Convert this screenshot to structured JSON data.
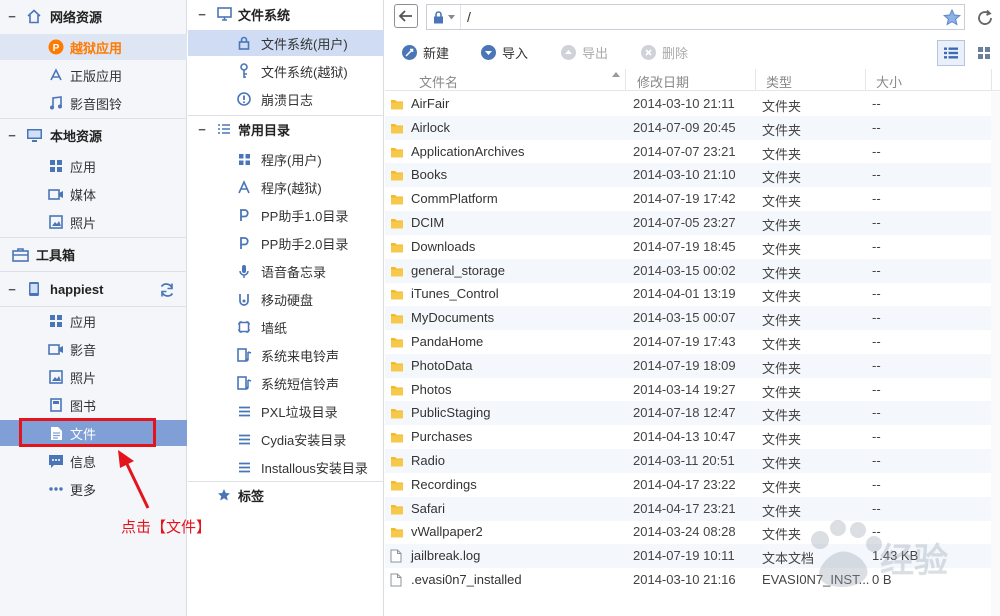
{
  "sidebar": {
    "groups": [
      {
        "title": "网络资源",
        "icon": "home-icon",
        "items": [
          {
            "label": "越狱应用",
            "icon": "pp-icon",
            "state": "active"
          },
          {
            "label": "正版应用",
            "icon": "appstore-icon"
          },
          {
            "label": "影音图铃",
            "icon": "music-icon"
          }
        ]
      },
      {
        "title": "本地资源",
        "icon": "monitor-icon",
        "items": [
          {
            "label": "应用",
            "icon": "grid-icon"
          },
          {
            "label": "媒体",
            "icon": "video-icon"
          },
          {
            "label": "照片",
            "icon": "photo-icon"
          }
        ]
      },
      {
        "title": "工具箱",
        "icon": "toolbox-icon",
        "items": []
      },
      {
        "title": "happiest",
        "icon": "phone-icon",
        "items": [
          {
            "label": "应用",
            "icon": "grid-icon"
          },
          {
            "label": "影音",
            "icon": "video-icon"
          },
          {
            "label": "照片",
            "icon": "photo-icon"
          },
          {
            "label": "图书",
            "icon": "book-icon"
          },
          {
            "label": "文件",
            "icon": "file-icon",
            "state": "selected"
          },
          {
            "label": "信息",
            "icon": "message-icon"
          },
          {
            "label": "更多",
            "icon": "more-icon"
          }
        ]
      }
    ]
  },
  "tree": {
    "filesystem_title": "文件系统",
    "filesystem_items": [
      {
        "label": "文件系统(用户)",
        "icon": "lock-icon",
        "selected": true
      },
      {
        "label": "文件系统(越狱)",
        "icon": "key-icon"
      },
      {
        "label": "崩溃日志",
        "icon": "alert-icon"
      }
    ],
    "common_title": "常用目录",
    "common_items": [
      {
        "label": "程序(用户)",
        "icon": "grid-icon"
      },
      {
        "label": "程序(越狱)",
        "icon": "app-a-icon"
      },
      {
        "label": "PP助手1.0目录",
        "icon": "pp-small-icon"
      },
      {
        "label": "PP助手2.0目录",
        "icon": "pp-small-icon"
      },
      {
        "label": "语音备忘录",
        "icon": "mic-icon"
      },
      {
        "label": "移动硬盘",
        "icon": "drive-icon"
      },
      {
        "label": "墙纸",
        "icon": "wallpaper-icon"
      },
      {
        "label": "系统来电铃声",
        "icon": "ringtone-icon"
      },
      {
        "label": "系统短信铃声",
        "icon": "ringtone-icon"
      },
      {
        "label": "PXL垃圾目录",
        "icon": "list-icon"
      },
      {
        "label": "Cydia安装目录",
        "icon": "list-icon"
      },
      {
        "label": "Installous安装目录",
        "icon": "list-icon"
      }
    ],
    "tags_title": "标签"
  },
  "address_bar": {
    "path": "/"
  },
  "toolbar": {
    "new_label": "新建",
    "import_label": "导入",
    "export_label": "导出",
    "delete_label": "删除"
  },
  "columns": {
    "name": "文件名",
    "date": "修改日期",
    "type": "类型",
    "size": "大小"
  },
  "files": [
    {
      "name": "AirFair",
      "date": "2014-03-10 21:11",
      "type": "文件夹",
      "size": "--",
      "kind": "folder"
    },
    {
      "name": "Airlock",
      "date": "2014-07-09 20:45",
      "type": "文件夹",
      "size": "--",
      "kind": "folder"
    },
    {
      "name": "ApplicationArchives",
      "date": "2014-07-07 23:21",
      "type": "文件夹",
      "size": "--",
      "kind": "folder"
    },
    {
      "name": "Books",
      "date": "2014-03-10 21:10",
      "type": "文件夹",
      "size": "--",
      "kind": "folder"
    },
    {
      "name": "CommPlatform",
      "date": "2014-07-19 17:42",
      "type": "文件夹",
      "size": "--",
      "kind": "folder"
    },
    {
      "name": "DCIM",
      "date": "2014-07-05 23:27",
      "type": "文件夹",
      "size": "--",
      "kind": "folder"
    },
    {
      "name": "Downloads",
      "date": "2014-07-19 18:45",
      "type": "文件夹",
      "size": "--",
      "kind": "folder"
    },
    {
      "name": "general_storage",
      "date": "2014-03-15 00:02",
      "type": "文件夹",
      "size": "--",
      "kind": "folder"
    },
    {
      "name": "iTunes_Control",
      "date": "2014-04-01 13:19",
      "type": "文件夹",
      "size": "--",
      "kind": "folder"
    },
    {
      "name": "MyDocuments",
      "date": "2014-03-15 00:07",
      "type": "文件夹",
      "size": "--",
      "kind": "folder"
    },
    {
      "name": "PandaHome",
      "date": "2014-07-19 17:43",
      "type": "文件夹",
      "size": "--",
      "kind": "folder"
    },
    {
      "name": "PhotoData",
      "date": "2014-07-19 18:09",
      "type": "文件夹",
      "size": "--",
      "kind": "folder"
    },
    {
      "name": "Photos",
      "date": "2014-03-14 19:27",
      "type": "文件夹",
      "size": "--",
      "kind": "folder"
    },
    {
      "name": "PublicStaging",
      "date": "2014-07-18 12:47",
      "type": "文件夹",
      "size": "--",
      "kind": "folder"
    },
    {
      "name": "Purchases",
      "date": "2014-04-13 10:47",
      "type": "文件夹",
      "size": "--",
      "kind": "folder"
    },
    {
      "name": "Radio",
      "date": "2014-03-11 20:51",
      "type": "文件夹",
      "size": "--",
      "kind": "folder"
    },
    {
      "name": "Recordings",
      "date": "2014-04-17 23:22",
      "type": "文件夹",
      "size": "--",
      "kind": "folder"
    },
    {
      "name": "Safari",
      "date": "2014-04-17 23:21",
      "type": "文件夹",
      "size": "--",
      "kind": "folder"
    },
    {
      "name": "vWallpaper2",
      "date": "2014-03-24 08:28",
      "type": "文件夹",
      "size": "--",
      "kind": "folder"
    },
    {
      "name": "jailbreak.log",
      "date": "2014-07-19 10:11",
      "type": "文本文档",
      "size": "1.43 KB",
      "kind": "file"
    },
    {
      "name": ".evasi0n7_installed",
      "date": "2014-03-10 21:16",
      "type": "EVASI0N7_INST...",
      "size": "0 B",
      "kind": "file"
    }
  ],
  "annotation": {
    "text": "点击【文件】"
  },
  "colors": {
    "accent_orange": "#ff7a00",
    "selected_blue": "#7f9fd6",
    "tree_selected": "#cfdcf3",
    "annotation_red": "#e3141c",
    "folder_yellow": "#f5b921"
  }
}
